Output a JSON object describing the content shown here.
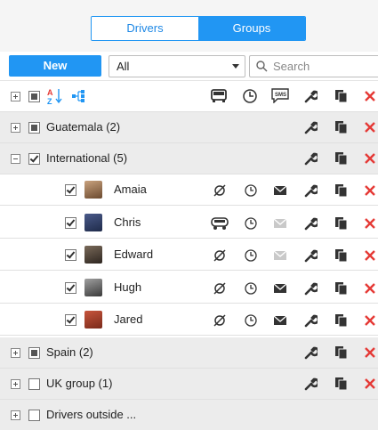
{
  "tabs": {
    "drivers": "Drivers",
    "groups": "Groups"
  },
  "toolbar": {
    "new_label": "New",
    "filter_value": "All",
    "search_placeholder": "Search"
  },
  "colors": {
    "accent": "#2196f3",
    "delete": "#e53935",
    "icon": "#333333",
    "muted": "#bdbdbd"
  },
  "header_icons": [
    "expand-all-icon",
    "select-all-checkbox",
    "sort-az-icon",
    "group-tree-icon",
    "vehicle-icon",
    "history-icon",
    "sms-icon",
    "settings-icon",
    "copy-icon",
    "delete-icon"
  ],
  "rows": {
    "guatemala": {
      "label": "Guatemala (2)"
    },
    "international": {
      "label": "International (5)"
    },
    "spain": {
      "label": "Spain (2)"
    },
    "uk": {
      "label": "UK group (1)"
    },
    "outside": {
      "label": "Drivers outside ..."
    }
  },
  "drivers": [
    {
      "name": "Amaia",
      "vehicle": "none",
      "message_active": true
    },
    {
      "name": "Chris",
      "vehicle": "car",
      "message_active": false
    },
    {
      "name": "Edward",
      "vehicle": "none",
      "message_active": false
    },
    {
      "name": "Hugh",
      "vehicle": "none",
      "message_active": true
    },
    {
      "name": "Jared",
      "vehicle": "none",
      "message_active": true
    }
  ]
}
